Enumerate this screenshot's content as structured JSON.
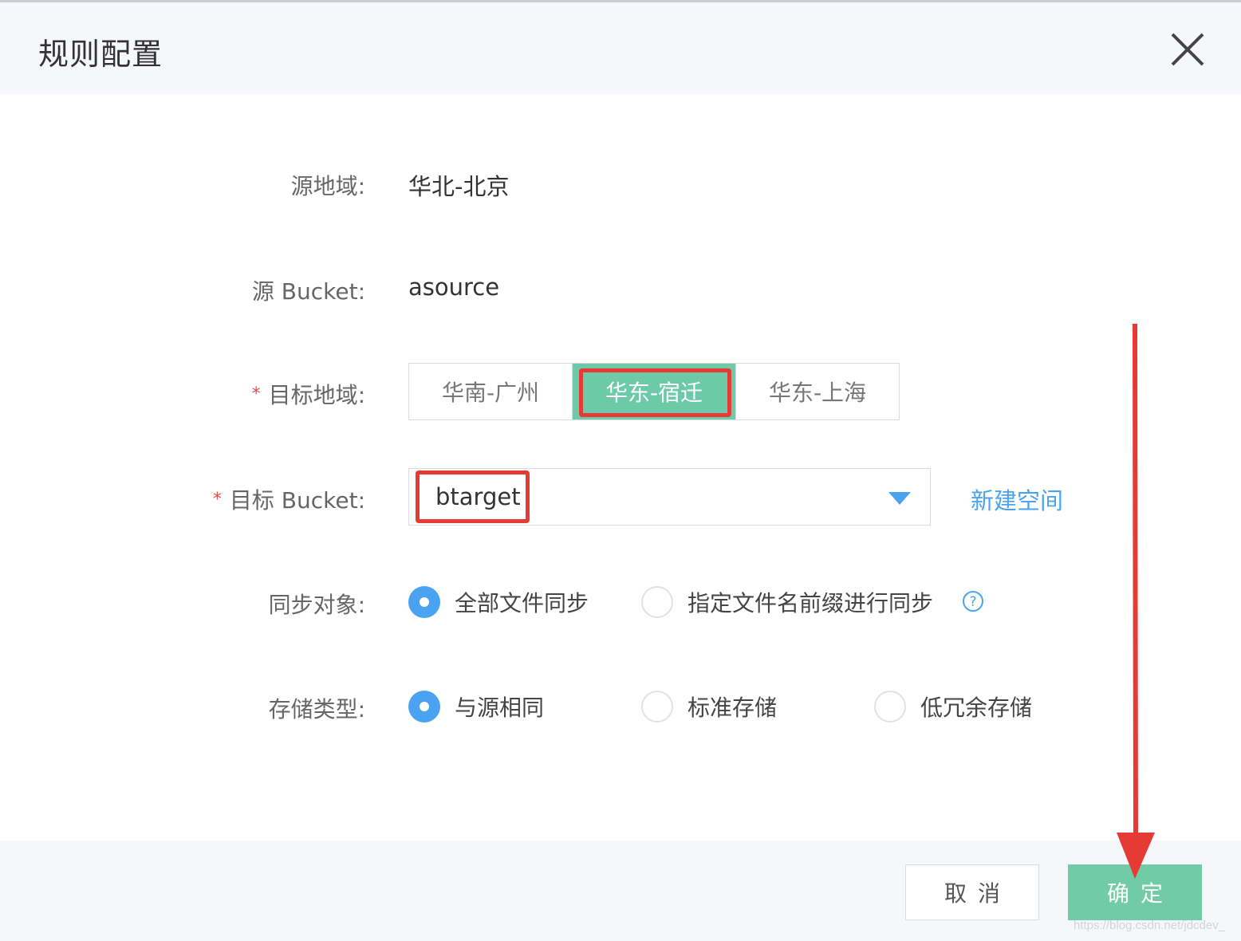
{
  "dialog": {
    "title": "规则配置"
  },
  "form": {
    "source_region": {
      "label": "源地域:",
      "value": "华北-北京"
    },
    "source_bucket": {
      "label": "源 Bucket:",
      "value": "asource"
    },
    "target_region": {
      "label": "目标地域:",
      "required_mark": "*",
      "options": [
        "华南-广州",
        "华东-宿迁",
        "华东-上海"
      ],
      "selected": "华东-宿迁"
    },
    "target_bucket": {
      "label": "目标 Bucket:",
      "required_mark": "*",
      "value": "btarget",
      "create_link": "新建空间"
    },
    "sync_object": {
      "label": "同步对象:",
      "options": [
        "全部文件同步",
        "指定文件名前缀进行同步"
      ],
      "selected": "全部文件同步"
    },
    "storage_type": {
      "label": "存储类型:",
      "options": [
        "与源相同",
        "标准存储",
        "低冗余存储"
      ],
      "selected": "与源相同"
    }
  },
  "footer": {
    "cancel_label": "取消",
    "ok_label": "确定"
  },
  "colors": {
    "accent_green": "#72cba7",
    "link_blue": "#4aa3f0",
    "highlight_red": "#e63b35",
    "required_red": "#e5504b"
  },
  "watermark": "https://blog.csdn.net/jdcdev_"
}
